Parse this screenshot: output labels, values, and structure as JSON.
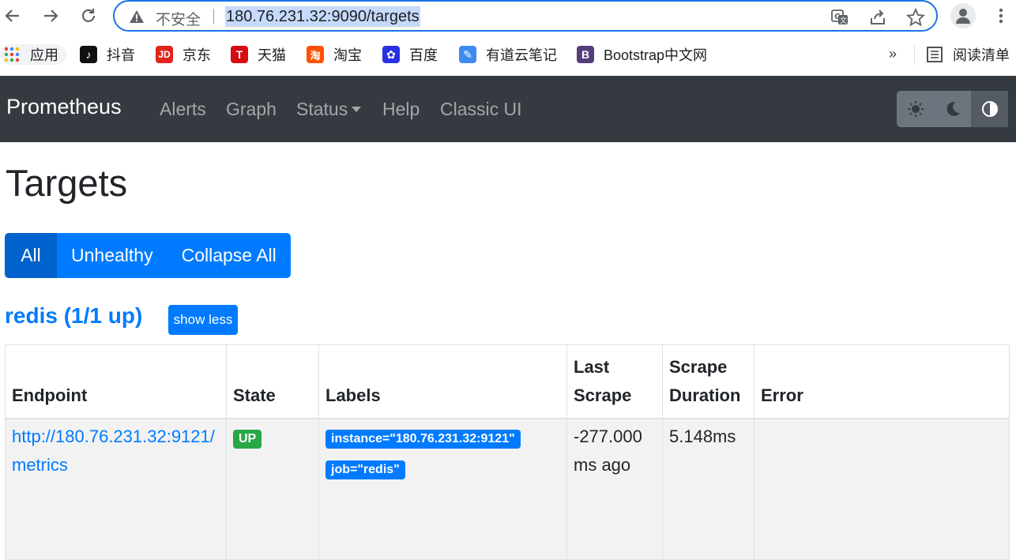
{
  "browser": {
    "insecure_label": "不安全",
    "url": "180.76.231.32:9090/targets"
  },
  "bookmarks": {
    "apps": "应用",
    "items": [
      {
        "label": "抖音",
        "icon": "douyin-icon",
        "color": "#111111"
      },
      {
        "label": "京东",
        "icon": "jd-icon",
        "color": "#e1251b"
      },
      {
        "label": "天猫",
        "icon": "tmall-icon",
        "color": "#d70b14"
      },
      {
        "label": "淘宝",
        "icon": "taobao-icon",
        "color": "#ff5000"
      },
      {
        "label": "百度",
        "icon": "baidu-icon",
        "color": "#2932e1"
      },
      {
        "label": "有道云笔记",
        "icon": "youdao-icon",
        "color": "#3d8bf2"
      },
      {
        "label": "Bootstrap中文网",
        "icon": "bootstrap-icon",
        "color": "#563d7c"
      }
    ],
    "more": "»",
    "reading_list": "阅读清单"
  },
  "navbar": {
    "brand": "Prometheus",
    "links": [
      "Alerts",
      "Graph",
      "Status",
      "Help",
      "Classic UI"
    ],
    "theme_buttons": [
      "light-theme-icon",
      "dark-theme-icon",
      "auto-theme-icon"
    ]
  },
  "page": {
    "title": "Targets",
    "filters": {
      "all": "All",
      "unhealthy": "Unhealthy",
      "collapse": "Collapse All"
    }
  },
  "job": {
    "title": "redis (1/1 up)",
    "toggle": "show less",
    "columns": [
      "Endpoint",
      "State",
      "Labels",
      "Last Scrape",
      "Scrape Duration",
      "Error"
    ],
    "rows": [
      {
        "endpoint": "http://180.76.231.32:9121/metrics",
        "state": "UP",
        "labels": [
          "instance=\"180.76.231.32:9121\"",
          "job=\"redis\""
        ],
        "last_scrape": "-277.000 ms ago",
        "scrape_duration": "5.148ms",
        "error": ""
      }
    ]
  },
  "colors": {
    "navbar": "#343a40",
    "primary": "#007bff",
    "success": "#28a745"
  }
}
